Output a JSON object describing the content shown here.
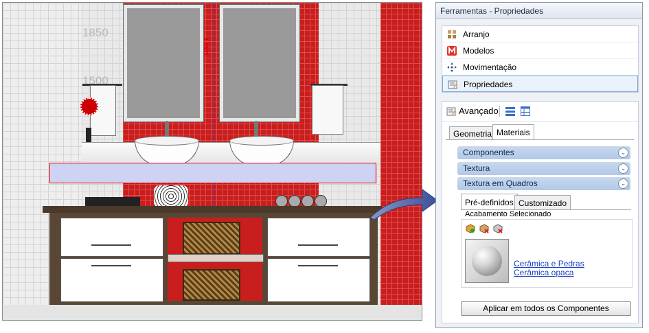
{
  "scene": {
    "dimension_labels": [
      "1850",
      "1500"
    ],
    "center_measure": "1450"
  },
  "panel": {
    "title": "Ferramentas - Propriedades",
    "nav_items": [
      {
        "label": "Arranjo",
        "icon": "arrange-icon"
      },
      {
        "label": "Modelos",
        "icon": "models-icon"
      },
      {
        "label": "Movimentação",
        "icon": "move-icon"
      },
      {
        "label": "Propriedades",
        "icon": "properties-icon",
        "active": true
      }
    ],
    "advanced": {
      "label": "Avançado",
      "tabs": [
        "Geometria",
        "Materiais"
      ],
      "selected_tab": "Materiais",
      "sections": [
        "Componentes",
        "Textura",
        "Textura em Quadros"
      ],
      "subtabs": [
        "Pré-definidos",
        "Customizado"
      ],
      "selected_subtab": "Pré-definidos",
      "finish_group_label": "Acabamento Selecionado",
      "material_links": [
        "Cerâmica e Pedras",
        "Cerâmica opaca"
      ],
      "apply_button": "Aplicar em todos os Componentes"
    }
  },
  "colors": {
    "accent_red": "#c81e1e",
    "nav_active_border": "#7ea5d3",
    "section_header": "#b2c8e6"
  }
}
